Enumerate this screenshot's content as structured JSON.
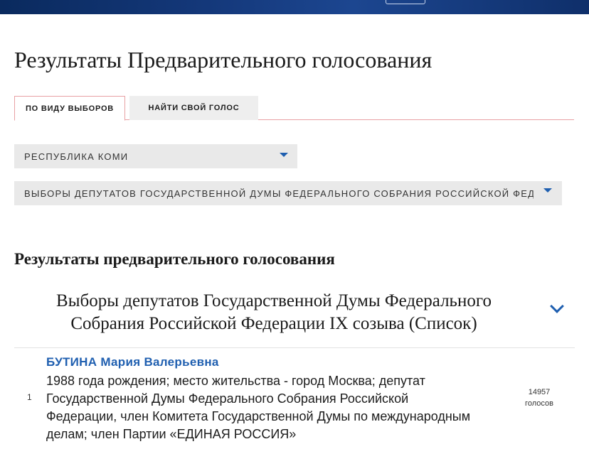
{
  "header": {
    "title": "Результаты Предварительного голосования"
  },
  "tabs": [
    {
      "label": "по виду выборов"
    },
    {
      "label": "найти свой голос"
    }
  ],
  "filters": {
    "region": "РЕСПУБЛИКА КОМИ",
    "election": "ВЫБОРЫ ДЕПУТАТОВ ГОСУДАРСТВЕННОЙ ДУМЫ ФЕДЕРАЛЬНОГО СОБРАНИЯ РОССИЙСКОЙ ФЕДЕРАЦИИ IX СОЗЫВА (СПИСОК)"
  },
  "results": {
    "section_title": "Результаты предварительного голосования",
    "election_title": "Выборы депутатов Государственной Думы Федерального Собрания Российской Федерации IX созыва (Список)",
    "candidates": [
      {
        "number": "1",
        "name": "БУТИНА Мария Валерьевна",
        "description": "1988 года рождения; место жительства - город Москва; депутат Государственной Думы Федерального Собрания Российской Федерации, член Комитета Государственной Думы по международным делам; член Партии «ЕДИНАЯ РОССИЯ»",
        "votes": "14957",
        "votes_label": "голосов"
      }
    ]
  },
  "colors": {
    "accent": "#1f5fb0",
    "tab_border": "#e8a0a3",
    "select_bg": "#e9e9e9"
  }
}
